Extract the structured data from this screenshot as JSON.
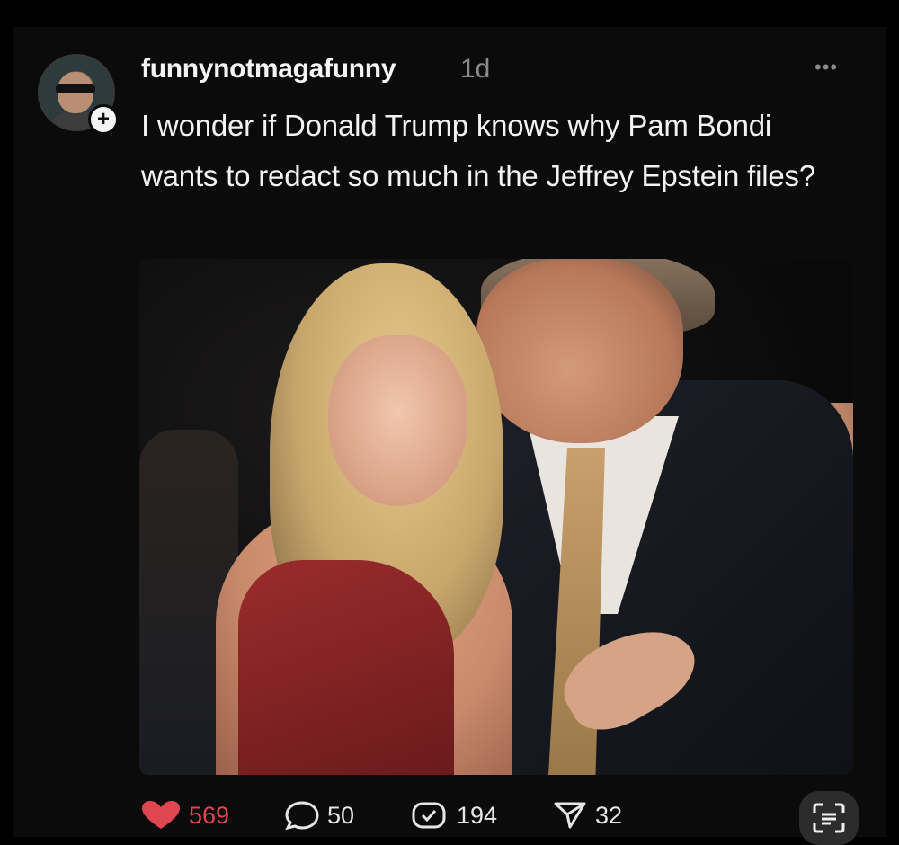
{
  "post": {
    "username": "funnynotmagafunny",
    "time": "1d",
    "more": "•••",
    "follow": "+",
    "text": "I wonder if Donald Trump knows why Pam Bondi wants to redact so much in the Jeffrey Epstein files?"
  },
  "actions": {
    "likes": "569",
    "comments": "50",
    "reposts": "194",
    "shares": "32"
  },
  "colors": {
    "background": "#0b0b0b",
    "like": "#e04650",
    "muted": "#8a8a8a"
  },
  "icons": [
    "heart-icon",
    "comment-icon",
    "repost-icon",
    "share-icon",
    "scan-icon"
  ]
}
